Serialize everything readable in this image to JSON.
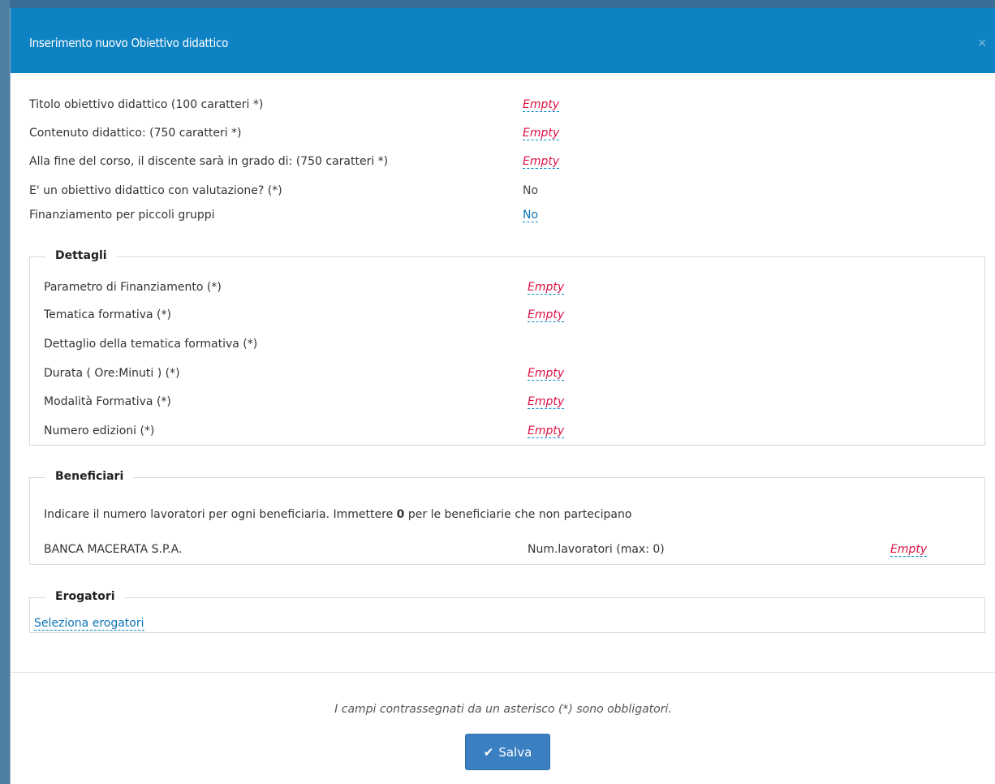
{
  "modal": {
    "title": "Inserimento nuovo Obiettivo didattico",
    "close_label": "×"
  },
  "fields": [
    {
      "label": "Titolo obiettivo didattico (100 caratteri *)",
      "value": "Empty"
    },
    {
      "label": "Contenuto didattico: (750 caratteri *)",
      "value": "Empty"
    },
    {
      "label": "Alla fine del corso, il discente sarà in grado di: (750 caratteri *)",
      "value": "Empty"
    },
    {
      "label": "E' un obiettivo didattico con valutazione? (*)",
      "value": "No"
    },
    {
      "label": "Finanziamento per piccoli gruppi",
      "value": "No"
    }
  ],
  "dettagli": {
    "legend": "Dettagli",
    "fields": [
      {
        "label": "Parametro di Finanziamento (*)",
        "value": "Empty"
      },
      {
        "label": "Tematica formativa (*)",
        "value": "Empty"
      },
      {
        "label": "Dettaglio della tematica formativa (*)",
        "value": ""
      },
      {
        "label": "Durata ( Ore:Minuti ) (*)",
        "value": "Empty"
      },
      {
        "label": "Modalità Formativa (*)",
        "value": "Empty"
      },
      {
        "label": "Numero edizioni (*)",
        "value": "Empty"
      }
    ]
  },
  "beneficiari": {
    "legend": "Beneficiari",
    "instruction_before": "Indicare il numero lavoratori per ogni beneficiaria. Immettere ",
    "instruction_bold": "0",
    "instruction_after": " per le beneficiarie che non partecipano",
    "rows": [
      {
        "name": "BANCA MACERATA S.P.A.",
        "label": "Num.lavoratori (max: 0)",
        "value": "Empty"
      }
    ]
  },
  "erogatori": {
    "legend": "Erogatori",
    "link": "Seleziona erogatori"
  },
  "footer": {
    "note": "I campi contrassegnati da un asterisco (*) sono obbligatori.",
    "save_label": "Salva"
  },
  "colors": {
    "header": "#0f82c4",
    "empty": "#dd1144",
    "link": "#0b74b8",
    "button": "#3a7fc1"
  }
}
